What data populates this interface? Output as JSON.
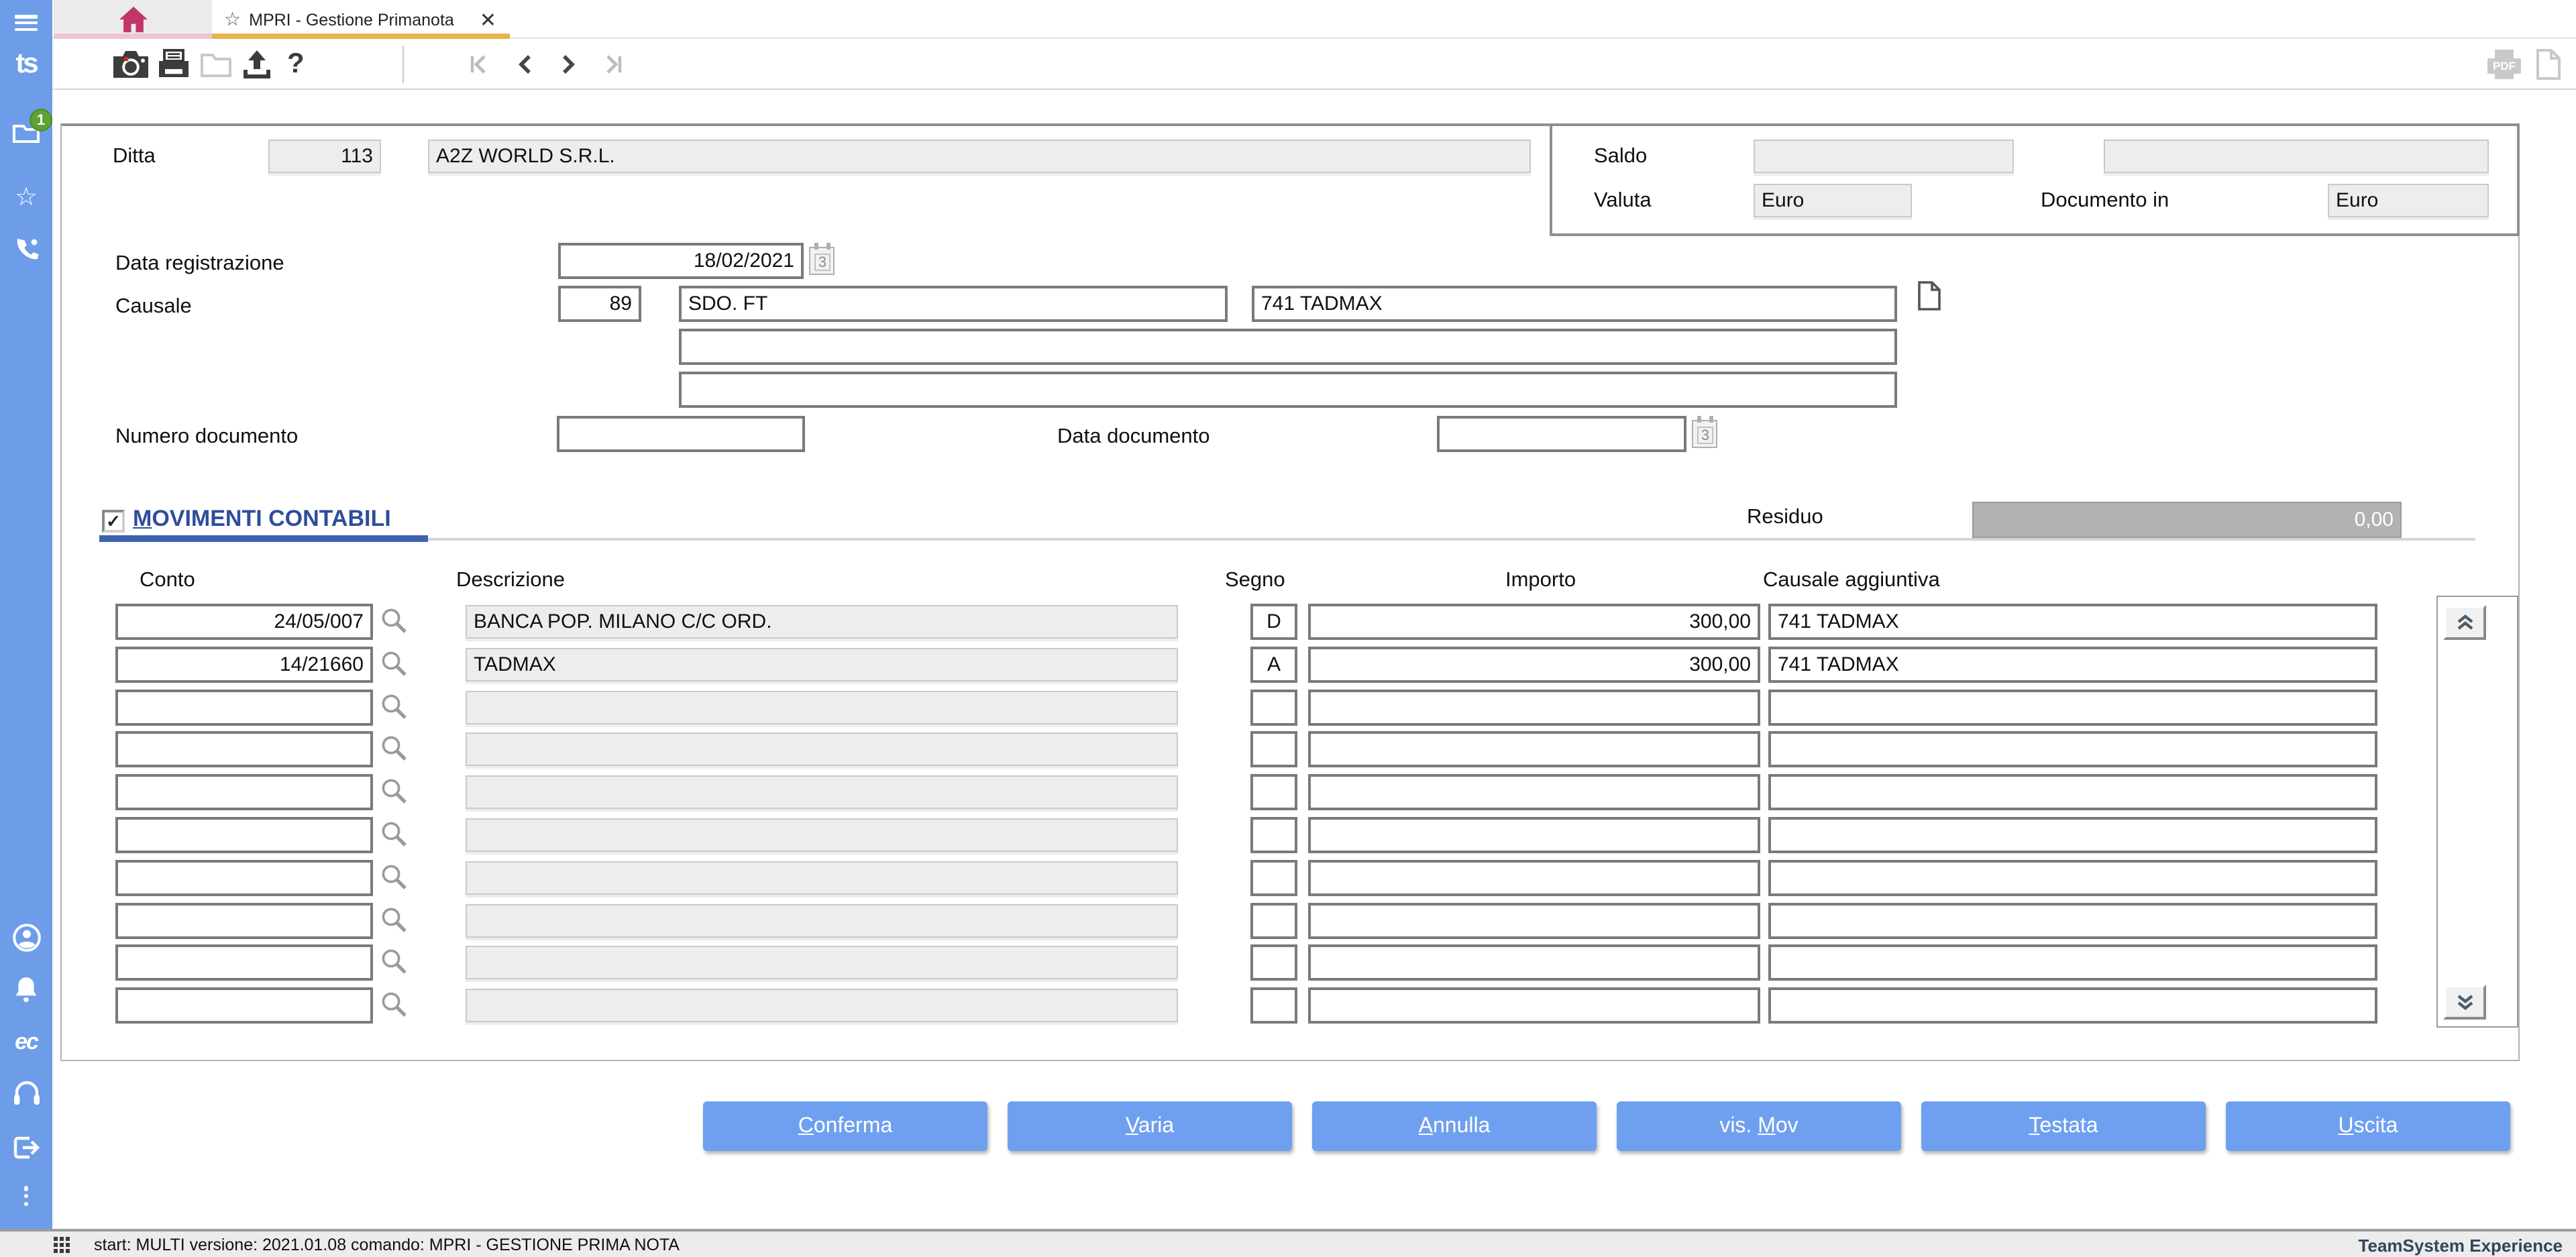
{
  "tabs": {
    "home": {
      "icon": "home-icon"
    },
    "active": {
      "title": "MPRI - Gestione Primanota",
      "star_icon": "favorite-star-icon",
      "close_icon": "close-icon"
    }
  },
  "sidebar": {
    "logo_glyph": "ts",
    "ec_glyph": "ec",
    "notifications_badge": "1",
    "icons": [
      "menu-icon",
      "teamsystem-logo",
      "documents-folder-icon",
      "favorites-star-icon",
      "phone-icon",
      "user-icon",
      "bell-icon",
      "ec-logo",
      "headset-icon",
      "logout-icon",
      "more-dots-icon"
    ]
  },
  "toolbar": {
    "left_icons": [
      "camera-icon",
      "print-icon",
      "folder-icon",
      "export-icon",
      "help-icon"
    ],
    "help_glyph": "?",
    "nav_icons": [
      "nav-first-icon",
      "nav-previous-icon",
      "nav-next-icon",
      "nav-last-icon"
    ],
    "right_icons": [
      "pdf-print-icon",
      "new-document-icon",
      "edit-pencil-icon"
    ],
    "pdf_icon_text": "PDF"
  },
  "form": {
    "ditta_label": "Ditta",
    "ditta_code": "113",
    "ditta_name": "A2Z WORLD S.R.L.",
    "saldo_label": "Saldo",
    "saldo_value_1": "",
    "saldo_value_2": "",
    "valuta_label": "Valuta",
    "valuta_value": "Euro",
    "documento_in_label": "Documento in",
    "documento_in_value": "Euro",
    "data_registrazione_label": "Data registrazione",
    "data_registrazione_value": "18/02/2021",
    "causale_label": "Causale",
    "causale_code": "89",
    "causale_desc": "SDO. FT",
    "causale_extra": "741 TADMAX",
    "causale_line2": "",
    "causale_line3": "",
    "numero_documento_label": "Numero documento",
    "numero_documento_value": "",
    "data_documento_label": "Data documento",
    "data_documento_value": "",
    "calendar_icon_text": "3"
  },
  "movimenti": {
    "section_title": "MOVIMENTI CONTABILI",
    "section_title_underline_index": 0,
    "checkbox_checked": "✓",
    "residuo_label": "Residuo",
    "residuo_value": "0,00",
    "columns": [
      "Conto",
      "Descrizione",
      "Segno",
      "Importo",
      "Causale aggiuntiva"
    ],
    "rows": [
      {
        "conto": "24/05/007",
        "descrizione": "BANCA POP. MILANO C/C ORD.",
        "segno": "D",
        "importo": "300,00",
        "causale_aggiuntiva": "741 TADMAX"
      },
      {
        "conto": "14/21660",
        "descrizione": "TADMAX",
        "segno": "A",
        "importo": "300,00",
        "causale_aggiuntiva": "741 TADMAX"
      },
      {
        "conto": "",
        "descrizione": "",
        "segno": "",
        "importo": "",
        "causale_aggiuntiva": ""
      },
      {
        "conto": "",
        "descrizione": "",
        "segno": "",
        "importo": "",
        "causale_aggiuntiva": ""
      },
      {
        "conto": "",
        "descrizione": "",
        "segno": "",
        "importo": "",
        "causale_aggiuntiva": ""
      },
      {
        "conto": "",
        "descrizione": "",
        "segno": "",
        "importo": "",
        "causale_aggiuntiva": ""
      },
      {
        "conto": "",
        "descrizione": "",
        "segno": "",
        "importo": "",
        "causale_aggiuntiva": ""
      },
      {
        "conto": "",
        "descrizione": "",
        "segno": "",
        "importo": "",
        "causale_aggiuntiva": ""
      },
      {
        "conto": "",
        "descrizione": "",
        "segno": "",
        "importo": "",
        "causale_aggiuntiva": ""
      },
      {
        "conto": "",
        "descrizione": "",
        "segno": "",
        "importo": "",
        "causale_aggiuntiva": ""
      }
    ]
  },
  "buttons": [
    {
      "name": "conferma-button",
      "label": "Conferma",
      "underline_index": 0
    },
    {
      "name": "varia-button",
      "label": "Varia",
      "underline_index": 0
    },
    {
      "name": "annulla-button",
      "label": "Annulla",
      "underline_index": 0
    },
    {
      "name": "vis-mov-button",
      "label": "vis. Mov",
      "underline_index": 5
    },
    {
      "name": "testata-button",
      "label": "Testata",
      "underline_index": 0
    },
    {
      "name": "uscita-button",
      "label": "Uscita",
      "underline_index": 0
    }
  ],
  "statusbar": {
    "text": "start: MULTI versione: 2021.01.08 comando: MPRI - GESTIONE PRIMA NOTA",
    "brand": "TeamSystem Experience"
  },
  "colors": {
    "sidebar_blue": "#6D9DE8",
    "button_blue": "#6FA0EF",
    "tab_active_underline": "#E7B44C",
    "home_tab_underline": "#EFC3D6",
    "home_icon_pink": "#C2356B",
    "section_title_blue": "#2E4D9B",
    "section_bar_blue": "#3E63AE",
    "residuo_field_gray": "#B2B2B2",
    "brand_navy": "#32465A"
  }
}
